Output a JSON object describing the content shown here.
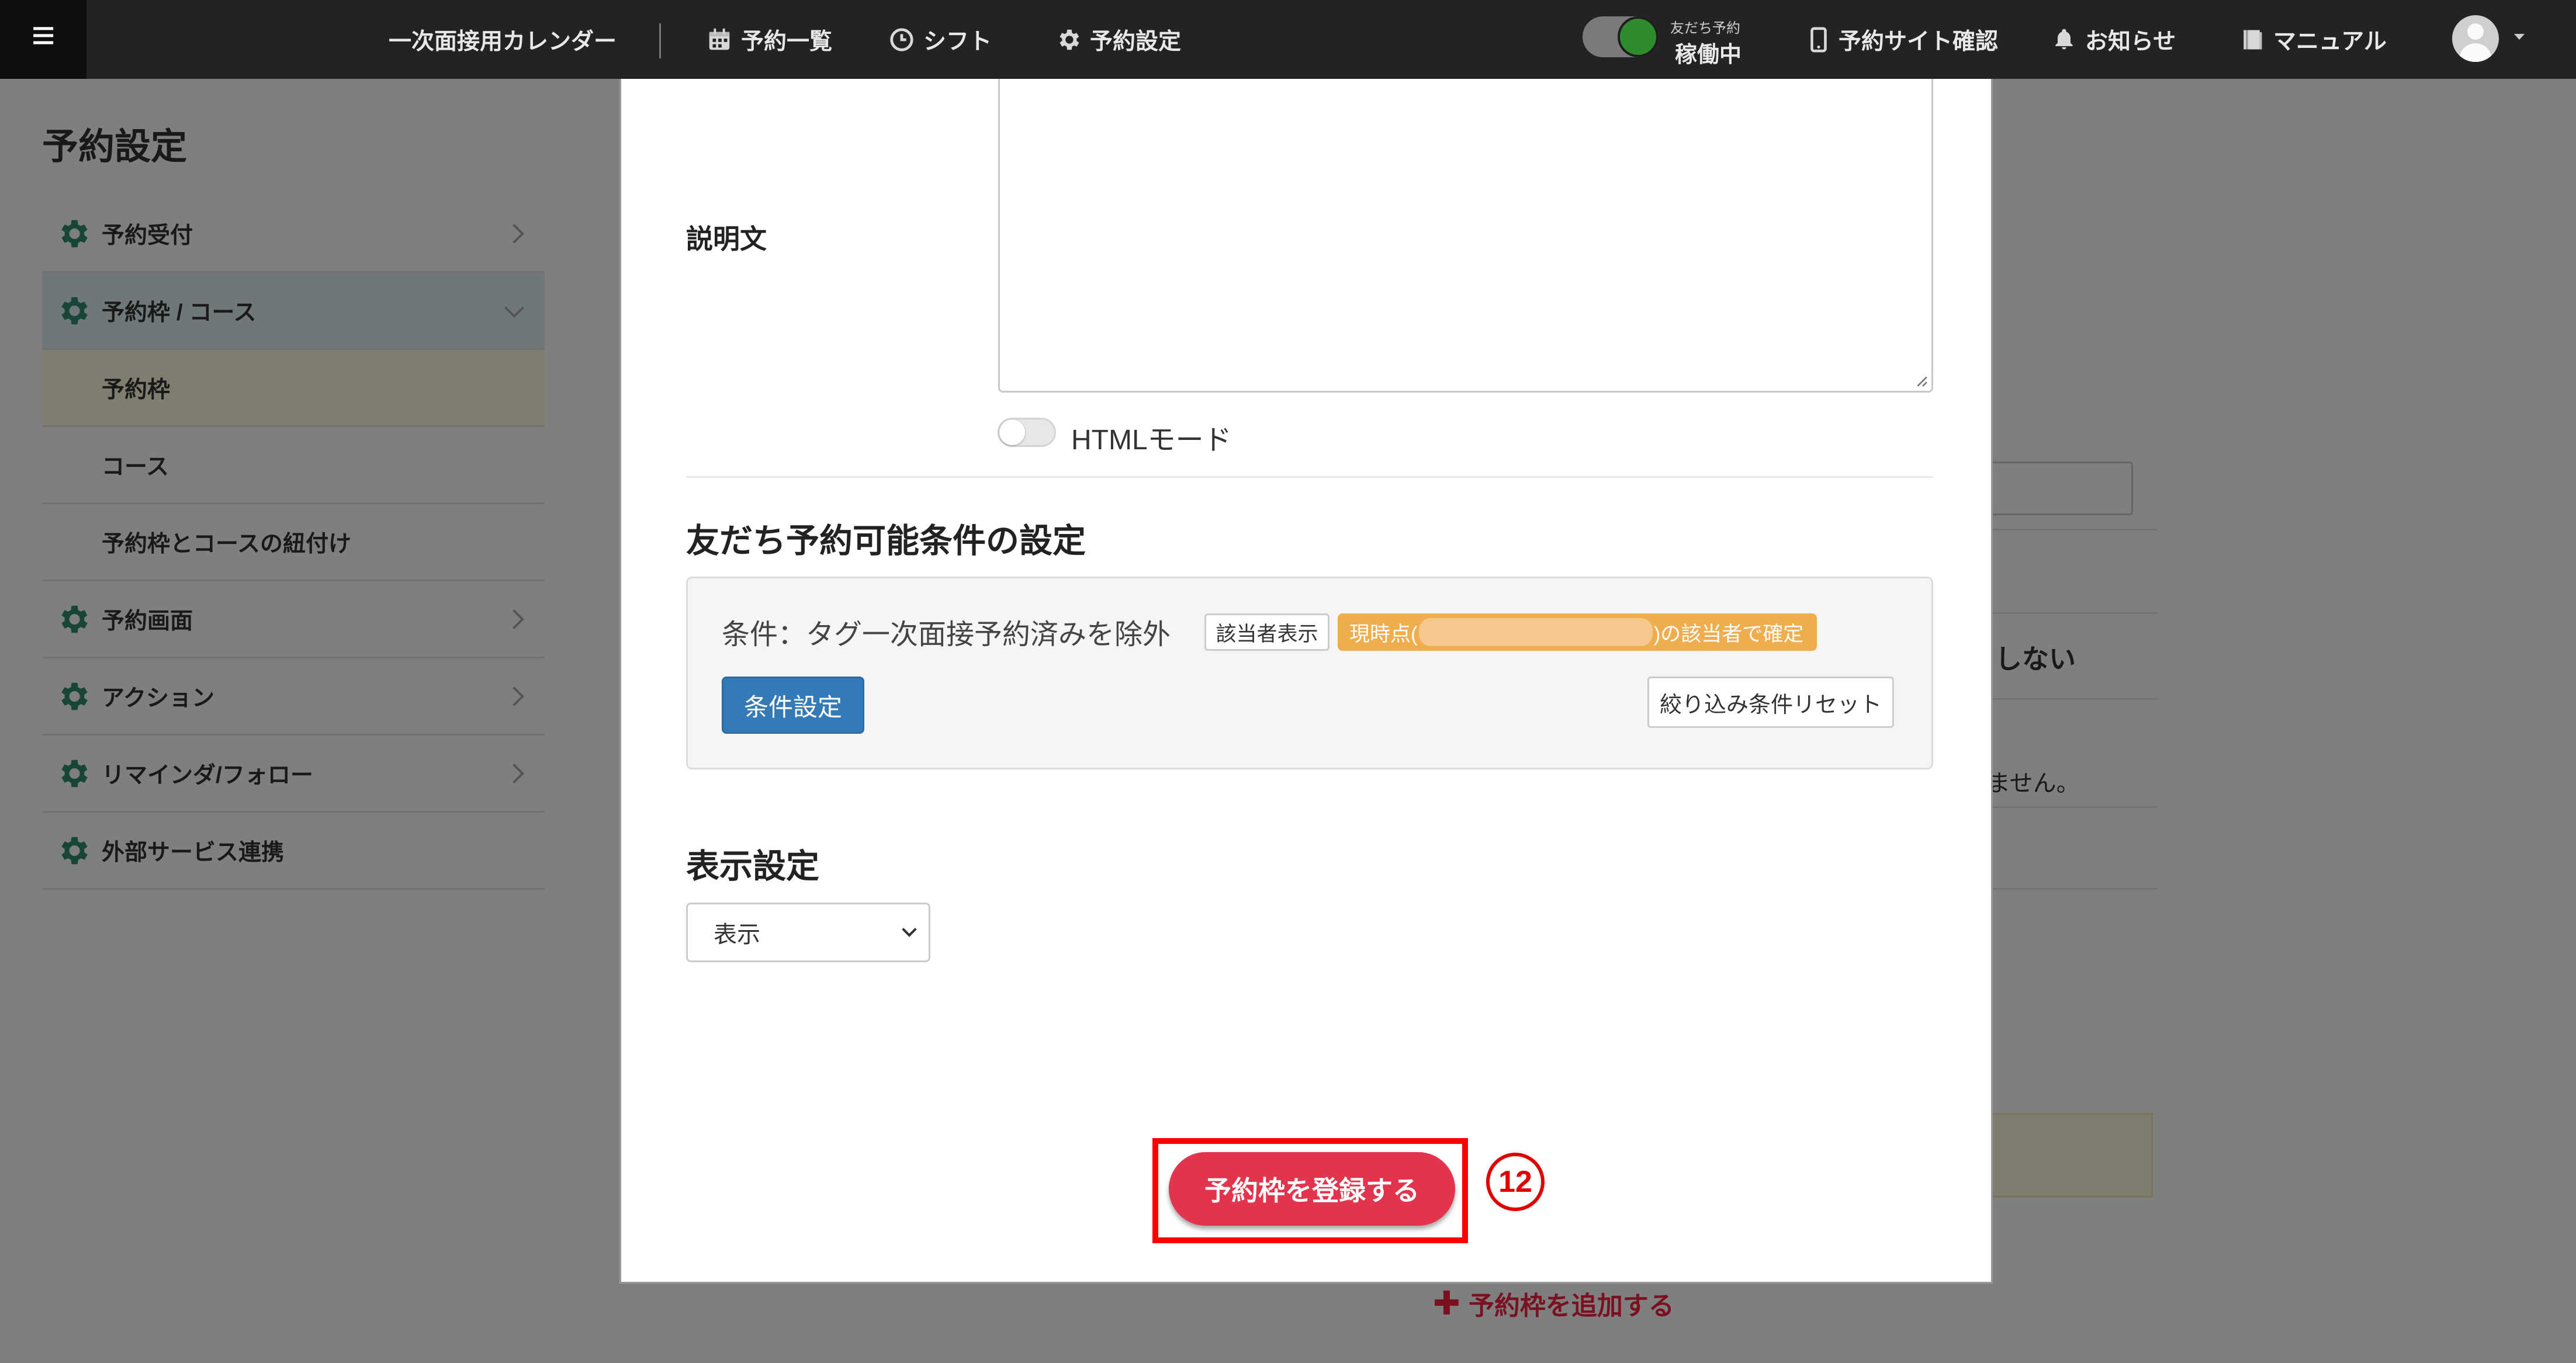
{
  "topbar": {
    "menu_glyph": "≡",
    "calendar_name": "一次面接用カレンダー",
    "nav": [
      {
        "label": "予約一覧",
        "icon": "calendar-icon"
      },
      {
        "label": "シフト",
        "icon": "clock-icon"
      },
      {
        "label": "予約設定",
        "icon": "gear-icon"
      }
    ],
    "status_small": "友だち予約",
    "status_text": "稼働中",
    "links": [
      {
        "label": "予約サイト確認",
        "icon": "smartphone-icon"
      },
      {
        "label": "お知らせ",
        "icon": "bell-icon"
      },
      {
        "label": "マニュアル",
        "icon": "book-icon"
      }
    ]
  },
  "page": {
    "title": "予約設定",
    "sidebar": [
      {
        "label": "予約受付",
        "type": "main"
      },
      {
        "label": "予約枠 / コース",
        "type": "main",
        "expanded": true
      },
      {
        "label": "予約枠",
        "type": "sub",
        "selected": true
      },
      {
        "label": "コース",
        "type": "sub"
      },
      {
        "label": "予約枠とコースの紐付け",
        "type": "sub"
      },
      {
        "label": "予約画面",
        "type": "main"
      },
      {
        "label": "アクション",
        "type": "main"
      },
      {
        "label": "リマインダ/フォロー",
        "type": "main"
      },
      {
        "label": "外部サービス連携",
        "type": "main"
      }
    ],
    "bg_fragment_1": "しない",
    "bg_fragment_2": "ません。",
    "add_link": "予約枠を追加する"
  },
  "modal": {
    "description_label": "説明文",
    "html_mode_label": "HTMLモード",
    "conditions_heading": "友だち予約可能条件の設定",
    "condition_text": "条件：タグ一次面接予約済みを除外",
    "show_matches_label": "該当者表示",
    "confirmed_prefix": "現時点(",
    "confirmed_suffix": ")の該当者で確定",
    "condition_button": "条件設定",
    "reset_button": "絞り込み条件リセット",
    "display_heading": "表示設定",
    "display_selected": "表示",
    "submit_button": "予約枠を登録する",
    "step_marker": "⑫"
  },
  "colors": {
    "topbar": "#232323",
    "accent_gear": "#2e8b6e",
    "submit": "#e3344e",
    "condition_btn": "#337ab7",
    "orange_pill": "#f0ad4e",
    "highlight": "#ff0000"
  }
}
